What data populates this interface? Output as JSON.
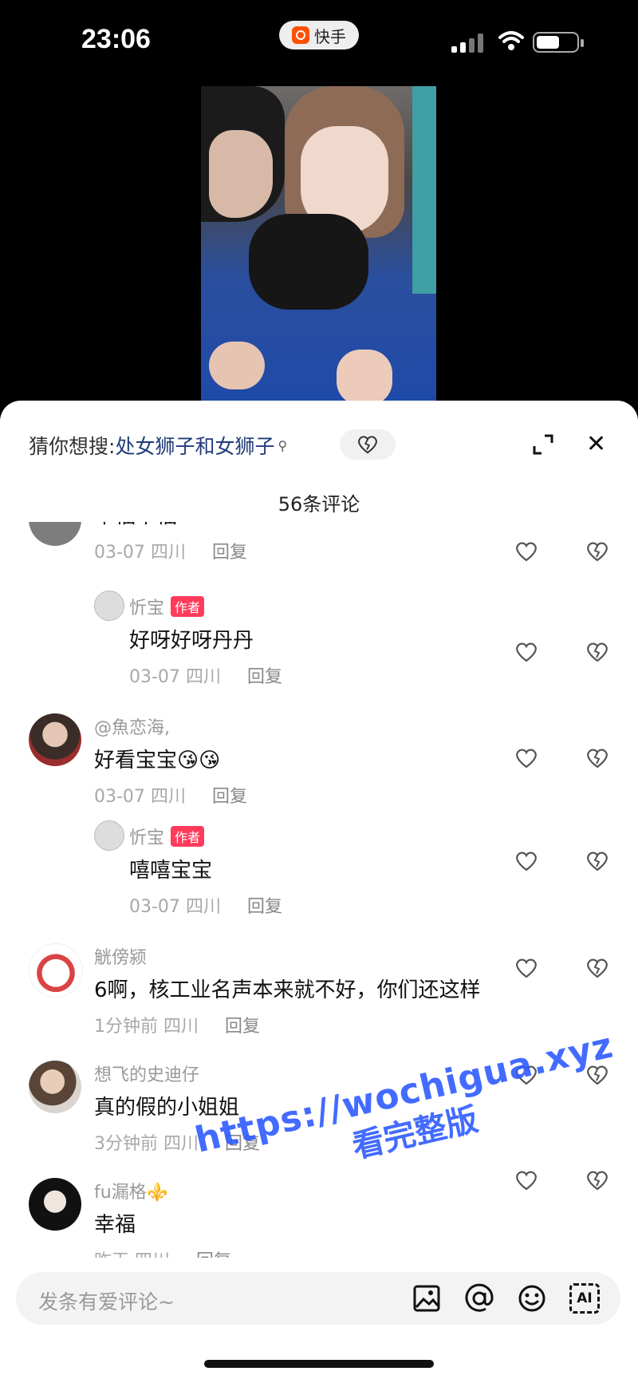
{
  "status_bar": {
    "time": "23:06",
    "app_name": "快手"
  },
  "panel": {
    "search_prefix": "猜你想搜:",
    "search_query": "处女狮子和女狮子",
    "comment_count": "56条评论"
  },
  "comments": [
    {
      "text": "幸福幸福",
      "date": "03-07",
      "location": "四川",
      "reply": "回复"
    },
    {
      "author": "忻宝",
      "badge": "作者",
      "text": "好呀好呀丹丹",
      "date": "03-07",
      "location": "四川",
      "reply": "回复"
    },
    {
      "author": "@魚恋海,",
      "text": "好看宝宝😘😘",
      "date": "03-07",
      "location": "四川",
      "reply": "回复"
    },
    {
      "author": "忻宝",
      "badge": "作者",
      "text": "嘻嘻宝宝",
      "date": "03-07",
      "location": "四川",
      "reply": "回复"
    },
    {
      "author": "觥傍颍",
      "text": "6啊，核工业名声本来就不好，你们还这样",
      "date": "1分钟前",
      "location": "四川",
      "reply": "回复"
    },
    {
      "author": "想飞的史迪仔",
      "text": "真的假的小姐姐",
      "date": "3分钟前",
      "location": "四川",
      "reply": "回复"
    },
    {
      "author": "fu漏格⚜️",
      "text": "幸福",
      "date": "昨天",
      "location": "四川",
      "reply": "回复"
    }
  ],
  "composer": {
    "placeholder": "发条有爱评论~",
    "ai_label": "AI"
  },
  "watermark": {
    "line1": "https://wochigua.xyz",
    "line2": "看完整版"
  },
  "icons": [
    "search-icon",
    "heart-break-icon",
    "expand-icon",
    "close-icon",
    "like-icon",
    "dislike-icon",
    "image-icon",
    "at-icon",
    "emoji-icon",
    "ai-icon"
  ]
}
